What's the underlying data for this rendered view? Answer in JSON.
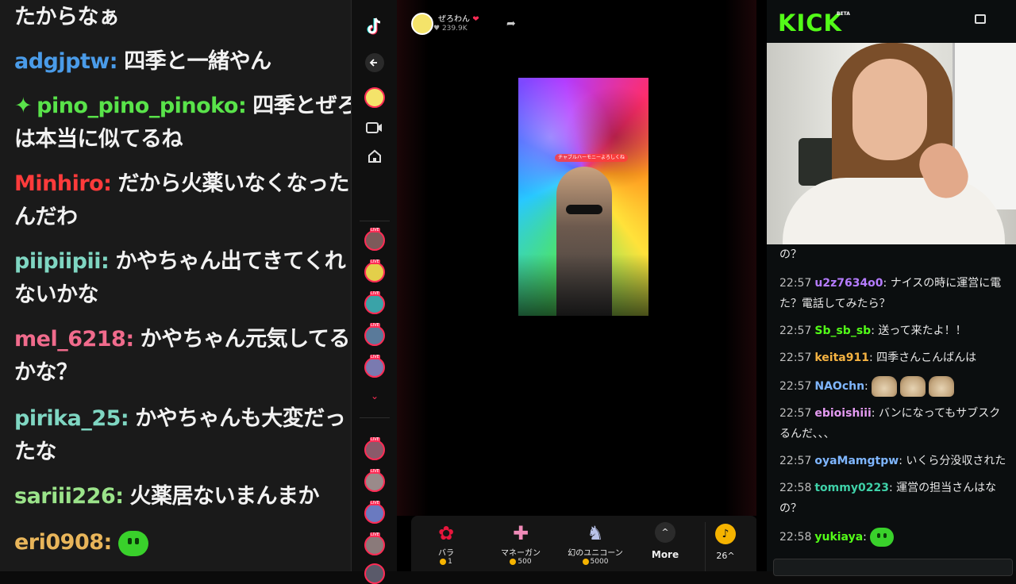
{
  "left_chat": {
    "messages": [
      {
        "user": "",
        "text": "たからなぁ",
        "color": "#ffffff"
      },
      {
        "user": "adgjptw:",
        "text": "四季と一緒やん",
        "color": "#4a9be8"
      },
      {
        "user": "pino_pino_pinoko:",
        "text": "四季とぜろ",
        "color": "#59e34a",
        "star": "✦"
      },
      {
        "user": "",
        "text": "は本当に似てるね",
        "color": "#ffffff"
      },
      {
        "user": "Minhiro:",
        "text": "だから火薬いなくなった",
        "color": "#ff3b3b"
      },
      {
        "user": "",
        "text": "んだわ",
        "color": "#ffffff"
      },
      {
        "user": "piipiipii:",
        "text": "かやちゃん出てきてくれ",
        "color": "#7fd6c2"
      },
      {
        "user": "",
        "text": "ないかな",
        "color": "#ffffff"
      },
      {
        "user": "mel_6218:",
        "text": "かやちゃん元気してる",
        "color": "#f06b8c"
      },
      {
        "user": "",
        "text": "かな？",
        "color": "#ffffff"
      },
      {
        "user": "pirika_25:",
        "text": "かやちゃんも大変だっ",
        "color": "#7fd6c2"
      },
      {
        "user": "",
        "text": "たな",
        "color": "#ffffff"
      },
      {
        "user": "sariii226:",
        "text": "火薬居ないまんまか",
        "color": "#9be38a"
      },
      {
        "user": "eri0908:",
        "text": "",
        "color": "#e8b55a",
        "emote": "green-blob"
      }
    ]
  },
  "tiktok": {
    "streamer_name": "ぜろわん",
    "likes": "239.9K",
    "gifts": [
      {
        "name": "バラ",
        "cost": "1",
        "icon": "rose-icon"
      },
      {
        "name": "マネーガン",
        "cost": "500",
        "icon": "money-gun-icon"
      },
      {
        "name": "幻のユニコーン",
        "cost": "5000",
        "icon": "unicorn-icon"
      }
    ],
    "more_label": "More",
    "coins_label": "26^",
    "video_banner": "チャブルハーモニーよろしくね"
  },
  "kick": {
    "logo": "KICK",
    "beta": "BETA",
    "messages": [
      {
        "time": "",
        "user": "",
        "text": "の？",
        "color": "#ffffff"
      },
      {
        "time": "22:57",
        "user": "u2z7634o0",
        "text": ": ナイスの時に運営に電",
        "color": "#b57cff"
      },
      {
        "time": "",
        "user": "",
        "text": "た？電話してみたら？",
        "color": "#ffffff"
      },
      {
        "time": "22:57",
        "user": "Sb_sb_sb",
        "text": ": 送って来たよ！！",
        "color": "#53fc18"
      },
      {
        "time": "22:57",
        "user": "keita911",
        "text": ": 四季さんこんばんは",
        "color": "#f5b342"
      },
      {
        "time": "22:57",
        "user": "NAOchn",
        "text": ":",
        "color": "#7fb6ff",
        "emote": "cat-x3"
      },
      {
        "time": "22:57",
        "user": "ebioishiii",
        "text": ": バンになってもサブスク",
        "color": "#e39af0"
      },
      {
        "time": "",
        "user": "",
        "text": "るんだ、、、",
        "color": "#ffffff"
      },
      {
        "time": "22:57",
        "user": "oyaMamgtpw",
        "text": ": いくら分没収された",
        "color": "#7fb6ff"
      },
      {
        "time": "22:58",
        "user": "tommy0223",
        "text": ": 運営の担当さんはな",
        "color": "#3fd1a8"
      },
      {
        "time": "",
        "user": "",
        "text": "の？",
        "color": "#ffffff"
      },
      {
        "time": "22:58",
        "user": "yukiaya",
        "text": ":",
        "color": "#53fc18",
        "emote": "green-blob"
      }
    ]
  }
}
